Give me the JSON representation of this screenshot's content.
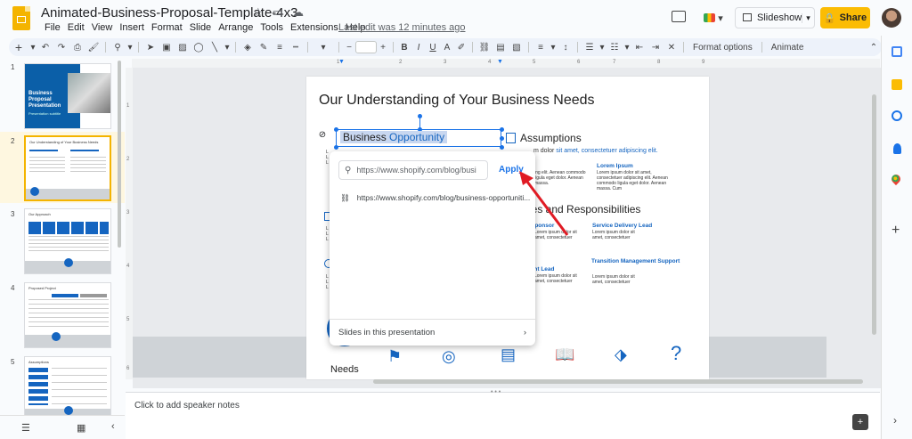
{
  "app": {
    "doc_title": "Animated-Business-Proposal-Template-4x3",
    "menu": [
      "File",
      "Edit",
      "View",
      "Insert",
      "Format",
      "Slide",
      "Arrange",
      "Tools",
      "Extensions",
      "Help"
    ],
    "last_edit": "Last edit was 12 minutes ago",
    "slideshow_label": "Slideshow",
    "share_label": "Share",
    "colors": {
      "accent": "#1a73e8",
      "share": "#fbbc04",
      "slide_blue": "#1565c0"
    }
  },
  "toolbar": {
    "format_options": "Format options",
    "animate": "Animate",
    "font_size_minus": "−",
    "font_size_plus": "+"
  },
  "ruler": {
    "marks": [
      "1",
      "2",
      "3",
      "4",
      "5",
      "6",
      "7",
      "8",
      "9"
    ],
    "vmarks": [
      "1",
      "2",
      "3",
      "4",
      "5",
      "6"
    ]
  },
  "filmstrip": {
    "slides": [
      {
        "num": "1",
        "title": "Business Proposal Presentation",
        "subtitle": "Presentation subtitle"
      },
      {
        "num": "2",
        "title": "Our Understanding of Your Business Needs"
      },
      {
        "num": "3",
        "title": "Our Approach"
      },
      {
        "num": "4",
        "title": "Proposed Project"
      },
      {
        "num": "5",
        "title": "Assumptions"
      }
    ]
  },
  "slide": {
    "title": "Our Understanding of Your Business Needs",
    "selected_text_a": "Business",
    "selected_text_b": " Opportunity",
    "assumptions": "Assumptions",
    "body_line_prefix": "m dolor ",
    "body_line_link": "sit amet, consectetuer adipiscing elit.",
    "lorem_heading": "Lorem Ipsum",
    "lorem_text_left": "ing elit. Aenean commodo ligula eget dolor. Aenean massa.",
    "lorem_text_right": "Lorem ipsum dolor sit amet, consectetuer adipiscing elit. Aenean commodo ligula eget dolor. Aenean massa. Cum",
    "roles_heading": "les and Responsibilities",
    "role_sponsor": "Sponsor",
    "role_service": "Service Delivery Lead",
    "role_mgmt": "ment Lead",
    "role_transition": "Transition Management Support",
    "role_text": "Lorem ipsum dolor sit amet, consectetuer",
    "needs_label": "Needs"
  },
  "link_popup": {
    "input_value": "https://www.shopify.com/blog/busi",
    "apply": "Apply",
    "suggestion": "https://www.shopify.com/blog/business-opportuniti...",
    "footer": "Slides in this presentation"
  },
  "notes": {
    "placeholder": "Click to add speaker notes"
  }
}
